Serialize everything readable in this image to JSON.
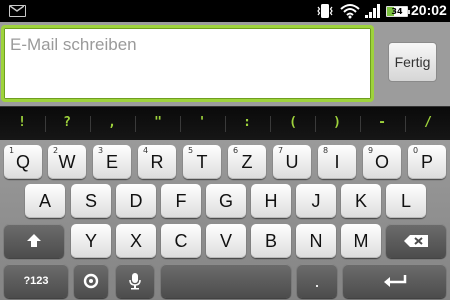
{
  "status_bar": {
    "time": "20:02",
    "battery_level": "34"
  },
  "compose": {
    "placeholder": "E-Mail schreiben",
    "done_label": "Fertig"
  },
  "punctuation": [
    "!",
    "?",
    ",",
    "\"",
    "'",
    ":",
    "(",
    ")",
    "-",
    "/"
  ],
  "keyboard": {
    "row1": [
      {
        "k": "Q",
        "alt": "1"
      },
      {
        "k": "W",
        "alt": "2"
      },
      {
        "k": "E",
        "alt": "3"
      },
      {
        "k": "R",
        "alt": "4"
      },
      {
        "k": "T",
        "alt": "5"
      },
      {
        "k": "Z",
        "alt": "6"
      },
      {
        "k": "U",
        "alt": "7"
      },
      {
        "k": "I",
        "alt": "8"
      },
      {
        "k": "O",
        "alt": "9"
      },
      {
        "k": "P",
        "alt": "0"
      }
    ],
    "row2": [
      "A",
      "S",
      "D",
      "F",
      "G",
      "H",
      "J",
      "K",
      "L"
    ],
    "row3": [
      "Y",
      "X",
      "C",
      "V",
      "B",
      "N",
      "M"
    ],
    "symbols_label": "?123",
    "period_label": "."
  },
  "colors": {
    "accent_green": "#9ed33c",
    "keyboard_bg": "#8e8e8e"
  }
}
